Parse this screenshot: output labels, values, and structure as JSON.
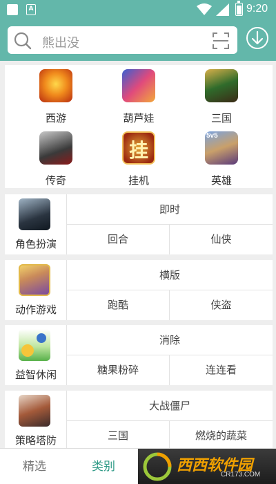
{
  "status_bar": {
    "time": "9:20",
    "notification_icon": "a-icon"
  },
  "search": {
    "placeholder": "熊出没",
    "scan_icon": "scan-icon",
    "download_icon": "download-icon"
  },
  "hot_categories": [
    {
      "label": "西游",
      "icon": "xiyou-icon"
    },
    {
      "label": "葫芦娃",
      "icon": "huluwa-icon"
    },
    {
      "label": "三国",
      "icon": "sanguo-icon"
    },
    {
      "label": "传奇",
      "icon": "chuanqi-icon"
    },
    {
      "label": "挂机",
      "icon": "guaji-icon",
      "icon_text": "挂"
    },
    {
      "label": "英雄",
      "icon": "yingxiong-icon",
      "icon_text": "5v5"
    }
  ],
  "categories": [
    {
      "name": "角色扮演",
      "top": "即时",
      "sub_left": "回合",
      "sub_right": "仙侠"
    },
    {
      "name": "动作游戏",
      "top": "横版",
      "sub_left": "跑酷",
      "sub_right": "侠盗"
    },
    {
      "name": "益智休闲",
      "top": "消除",
      "sub_left": "糖果粉碎",
      "sub_right": "连连看"
    },
    {
      "name": "策略塔防",
      "top": "大战僵尸",
      "sub_left": "三国",
      "sub_right": "燃烧的蔬菜"
    }
  ],
  "tabs": [
    {
      "label": "精选",
      "active": false
    },
    {
      "label": "类别",
      "active": true
    }
  ],
  "watermark": {
    "text": "西西软件园",
    "url": "CR173.COM"
  },
  "colors": {
    "header": "#63b7aa",
    "active_tab": "#2e9a86"
  }
}
